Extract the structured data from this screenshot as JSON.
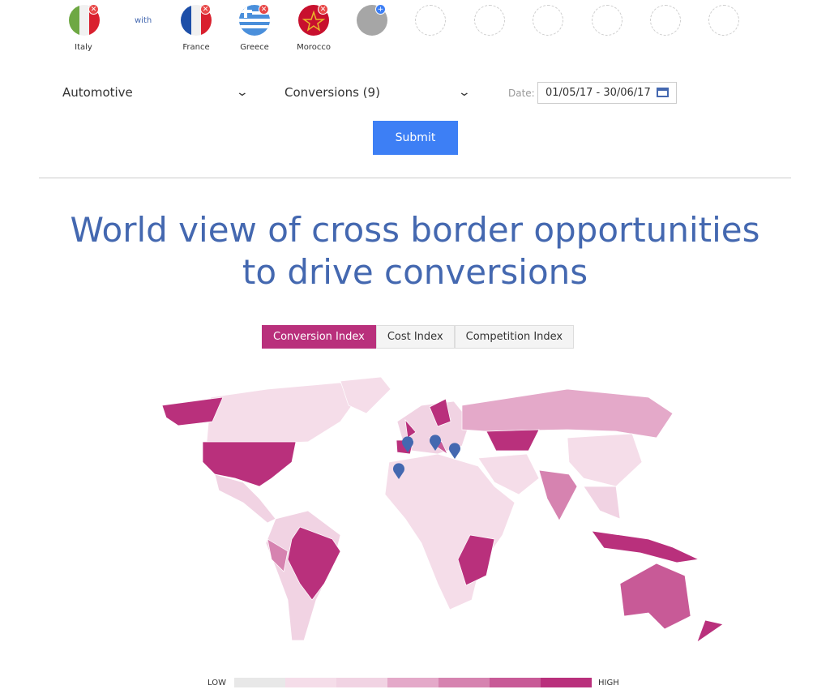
{
  "countries": {
    "base": {
      "name": "Italy",
      "action": "remove"
    },
    "connector": "with",
    "compare": [
      {
        "name": "France",
        "action": "remove"
      },
      {
        "name": "Greece",
        "action": "remove"
      },
      {
        "name": "Morocco",
        "action": "remove"
      }
    ],
    "add_slot": "add"
  },
  "filters": {
    "industry": "Automotive",
    "metric": "Conversions (9)",
    "date_label": "Date:",
    "date_value": "01/05/17 - 30/06/17",
    "submit": "Submit"
  },
  "title_line1": "World view of cross border opportunities",
  "title_line2": "to drive conversions",
  "tabs": [
    {
      "label": "Conversion Index",
      "active": true
    },
    {
      "label": "Cost Index",
      "active": false
    },
    {
      "label": "Competition Index",
      "active": false
    }
  ],
  "legend": {
    "low": "LOW",
    "high": "HIGH",
    "colors": [
      "#e8e8e8",
      "#f5dde9",
      "#f1d3e3",
      "#e4a9c9",
      "#d683b0",
      "#c85a97",
      "#b9307c"
    ]
  },
  "colors": {
    "accent": "#3d7ff5",
    "title": "#4468b0",
    "highlight": "#b9307c",
    "marker": "#4468b0"
  },
  "map_markers": [
    "France",
    "Italy",
    "Greece",
    "Morocco"
  ]
}
